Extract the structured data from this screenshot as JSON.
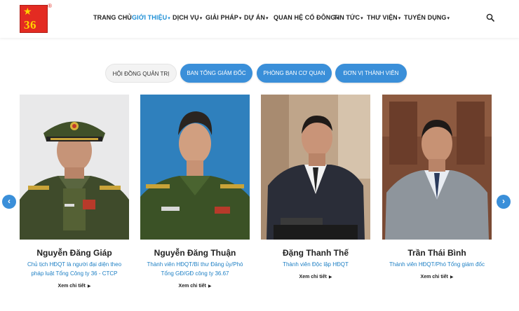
{
  "logo": {
    "number": "36",
    "star": "★",
    "reg": "®"
  },
  "nav": [
    {
      "label": "TRANG CHỦ",
      "caret": ""
    },
    {
      "label": "GIỚI THIỆU",
      "caret": "▾"
    },
    {
      "label": "DỊCH VỤ",
      "caret": "▾"
    },
    {
      "label": "GIẢI PHÁP",
      "caret": "▾"
    },
    {
      "label": "DỰ ÁN",
      "caret": "▾"
    },
    {
      "label": "QUAN HỆ CỔ ĐÔNG",
      "caret": "▾"
    },
    {
      "label": "TIN TỨC",
      "caret": "▾"
    },
    {
      "label": "THƯ VIỆN",
      "caret": "▾"
    },
    {
      "label": "TUYỂN DỤNG",
      "caret": "▾"
    }
  ],
  "tabs": [
    "HỘI ĐỒNG QUẢN TRỊ",
    "BAN TỔNG GIÁM ĐỐC",
    "PHÒNG BAN CƠ QUAN",
    "ĐƠN VỊ THÀNH VIÊN"
  ],
  "carousel": {
    "prev": "‹",
    "next": "›"
  },
  "members": [
    {
      "name": "Nguyễn Đăng Giáp",
      "role": "Chủ tịch HĐQT là người đại diện theo pháp luật Tổng Công ty 36 - CTCP",
      "more": "Xem chi tiết"
    },
    {
      "name": "Nguyễn Đăng Thuận",
      "role": "Thành viên HĐQT/Bí thư Đảng ủy/Phó Tổng GĐ/GĐ công ty 36.67",
      "more": "Xem chi tiết"
    },
    {
      "name": "Đặng Thanh Thế",
      "role": "Thành viên Độc lập HĐQT",
      "more": "Xem chi tiết"
    },
    {
      "name": "Trần Thái Bình",
      "role": "Thành viên HĐQT/Phó Tổng giám đốc",
      "more": "Xem chi tiết"
    }
  ],
  "colors": {
    "accent": "#3a8fd9",
    "brand_red": "#e32b22",
    "role_text": "#1d7fc4"
  }
}
